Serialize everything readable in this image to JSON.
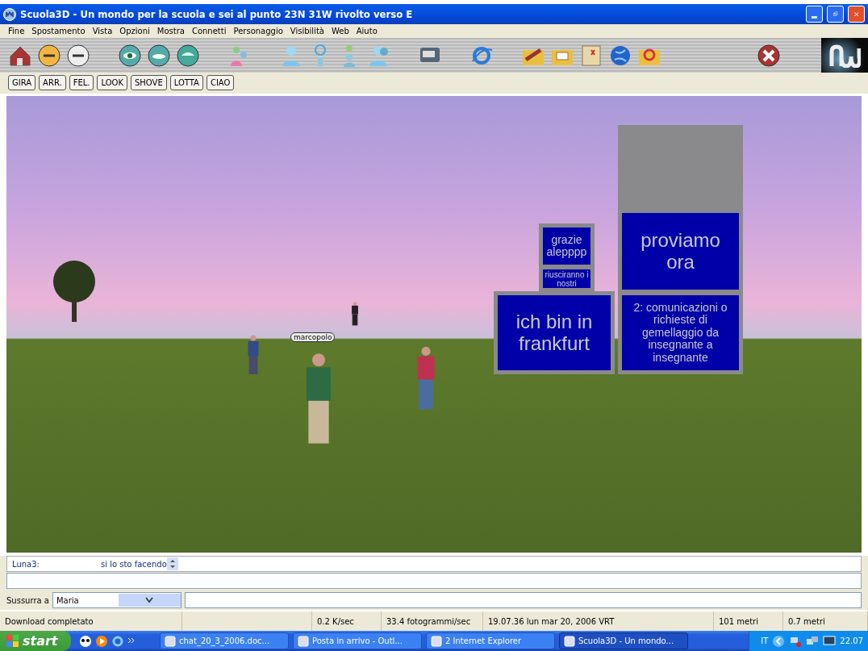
{
  "window": {
    "title": "Scuola3D - Un mondo per la scuola e sei al punto 23N 31W rivolto verso E"
  },
  "menu": [
    "Fine",
    "Spostamento",
    "Vista",
    "Opzioni",
    "Mostra",
    "Connetti",
    "Personaggio",
    "Visibilità",
    "Web",
    "Aiuto"
  ],
  "gesture_buttons": [
    "GIRA",
    "ARR.",
    "FEL.",
    "LOOK",
    "SHOVE",
    "LOTTA",
    "CIAO"
  ],
  "world": {
    "signs": [
      {
        "kind": "small",
        "text": "grazie alepppp"
      },
      {
        "kind": "tiny",
        "text": "riusciranno i nostri"
      },
      {
        "kind": "large",
        "text": "proviamo ora"
      },
      {
        "kind": "large",
        "text": "ich bin in frankfurt"
      },
      {
        "kind": "medium",
        "text": "2: comunicazioni o richieste di gemellaggio da insegnante a insegnante"
      }
    ],
    "nametag": "marcopolo"
  },
  "chat": {
    "messages": [
      {
        "sender": "Luna3:",
        "text": "si lo sto facendo"
      }
    ]
  },
  "whisper": {
    "label": "Sussurra a",
    "recipient": "Maria"
  },
  "status_bar": [
    "Download completato",
    "0.2 K/sec",
    "33.4 fotogrammi/sec",
    "19.07.36 lun mar 20, 2006 VRT",
    "101 metri",
    "0.7 metri"
  ],
  "taskbar": {
    "start": "start",
    "tasks": [
      {
        "label": "chat_20_3_2006.doc...",
        "selected": false
      },
      {
        "label": "Posta in arrivo - Outl...",
        "selected": false
      },
      {
        "label": "2 Internet Explorer",
        "selected": false
      },
      {
        "label": "Scuola3D - Un mondo...",
        "selected": true
      }
    ],
    "language": "IT",
    "clock": "22.07"
  }
}
